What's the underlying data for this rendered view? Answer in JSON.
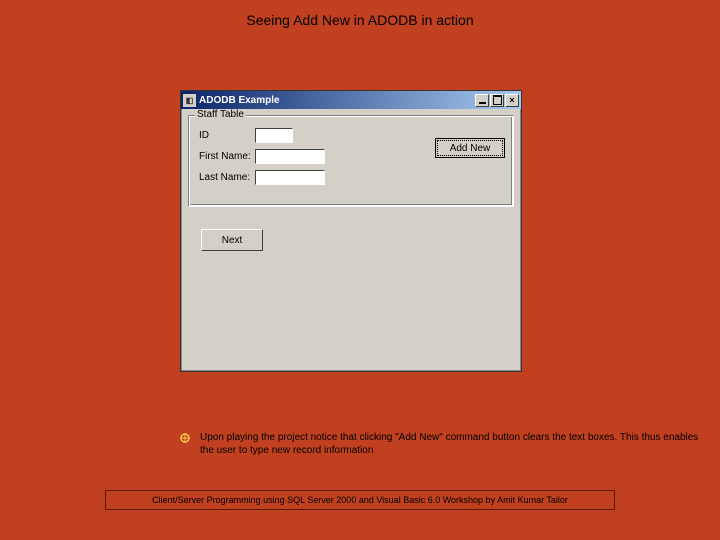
{
  "slide": {
    "title": "Seeing Add New in ADODB in action"
  },
  "window": {
    "title": "ADODB Example",
    "groupbox_label": "Staff Table",
    "fields": {
      "id_label": "ID",
      "first_name_label": "First Name:",
      "last_name_label": "Last Name:",
      "id_value": "",
      "first_name_value": "",
      "last_name_value": ""
    },
    "buttons": {
      "add_new": "Add New",
      "next": "Next"
    },
    "controls": {
      "close": "×"
    }
  },
  "note": {
    "text": "Upon playing the project notice that clicking \"Add New\" command button clears the text boxes. This thus enables the user to type new record information"
  },
  "footer": {
    "text": "Client/Server Programming using SQL Server 2000 and Visual Basic 6.0 Workshop by Amit Kumar Tailor"
  }
}
